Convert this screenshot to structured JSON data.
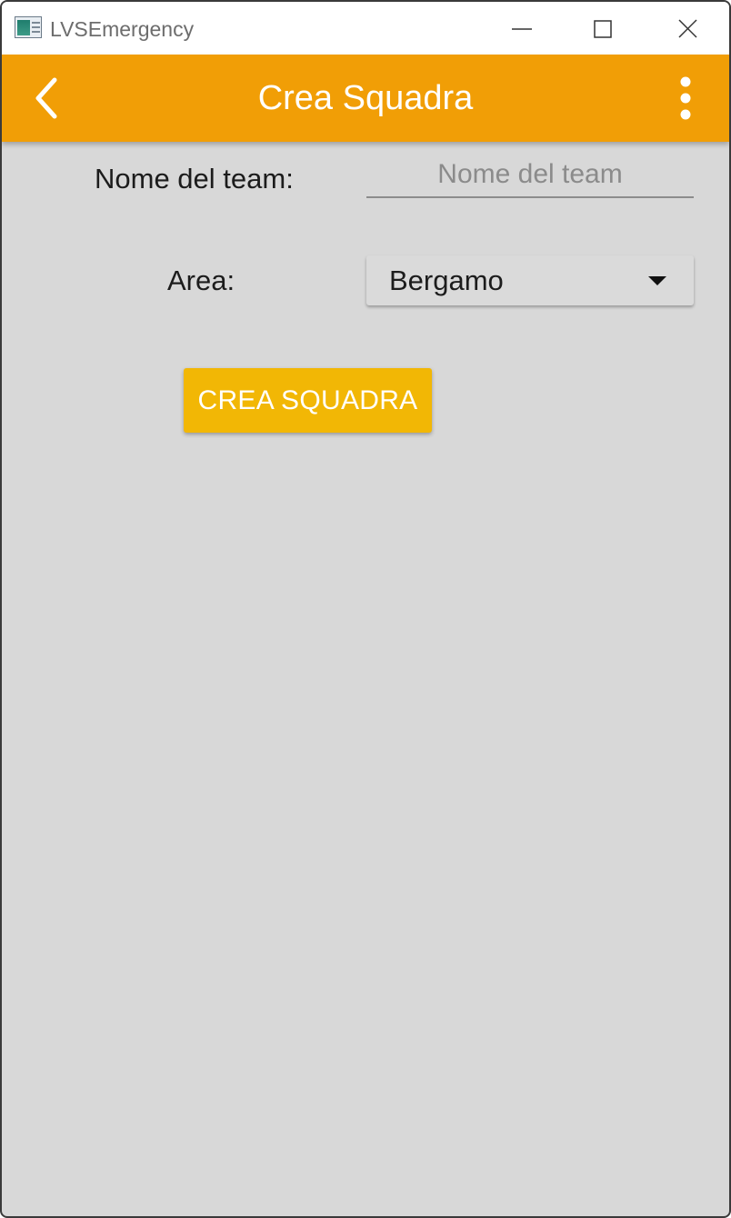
{
  "window": {
    "title": "LVSEmergency",
    "controls": {
      "minimize": "minimize-icon",
      "maximize": "maximize-icon",
      "close": "close-icon"
    }
  },
  "appbar": {
    "title": "Crea Squadra",
    "back_icon": "chevron-left-icon",
    "menu_icon": "more-vertical-icon",
    "color": "#f19e06"
  },
  "form": {
    "team_name": {
      "label": "Nome del team:",
      "placeholder": "Nome del team",
      "value": ""
    },
    "area": {
      "label": "Area:",
      "selected": "Bergamo"
    },
    "submit_label": "CREA SQUADRA",
    "submit_color": "#f2b705"
  },
  "colors": {
    "background": "#d8d8d8",
    "text": "#1c1c1c"
  }
}
